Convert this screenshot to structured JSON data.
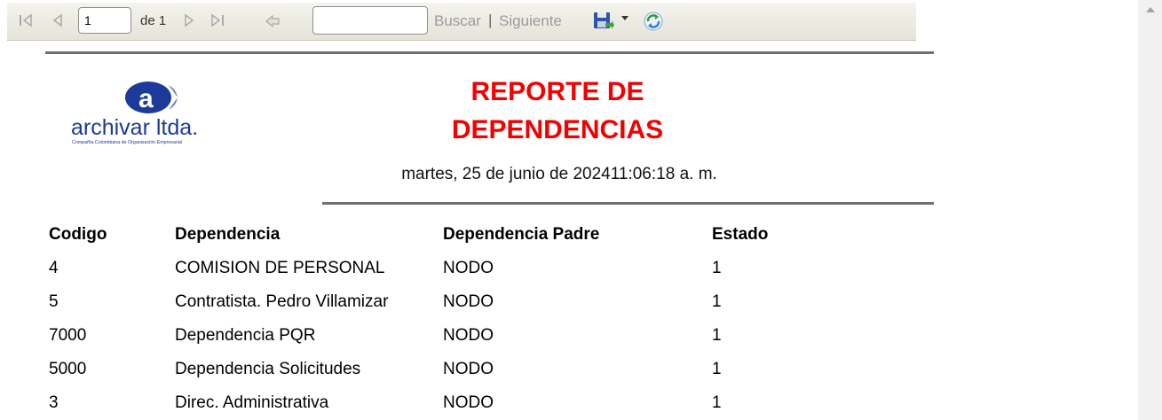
{
  "toolbar": {
    "page_value": "1",
    "of_pages": "de 1",
    "find_label": "Buscar",
    "separator": "|",
    "next_label": "Siguiente",
    "icons": [
      "first-page-icon",
      "previous-page-icon",
      "next-page-icon",
      "last-page-icon",
      "back-icon",
      "save-export-icon",
      "dropdown-arrow-icon",
      "refresh-icon"
    ]
  },
  "report": {
    "logo_text": "archivar ltda.",
    "logo_tagline": "Compañía Colombiana de Organización Empresarial",
    "logo_letter": "a",
    "title_line1": "REPORTE DE",
    "title_line2": "DEPENDENCIAS",
    "datetime": "martes, 25 de junio de 202411:06:18 a. m.",
    "columns": [
      "Codigo",
      "Dependencia",
      "Dependencia Padre",
      "Estado"
    ],
    "rows": [
      [
        "4",
        "COMISION DE PERSONAL",
        "NODO",
        "1"
      ],
      [
        "5",
        "Contratista. Pedro Villamizar",
        "NODO",
        "1"
      ],
      [
        "7000",
        "Dependencia PQR",
        "NODO",
        "1"
      ],
      [
        "5000",
        "Dependencia Solicitudes",
        "NODO",
        "1"
      ],
      [
        "3",
        "Direc. Administrativa",
        "NODO",
        "1"
      ]
    ]
  },
  "colors": {
    "title": "#f40000",
    "logo_blue": "#1b3a9a",
    "rule": "#707070"
  }
}
